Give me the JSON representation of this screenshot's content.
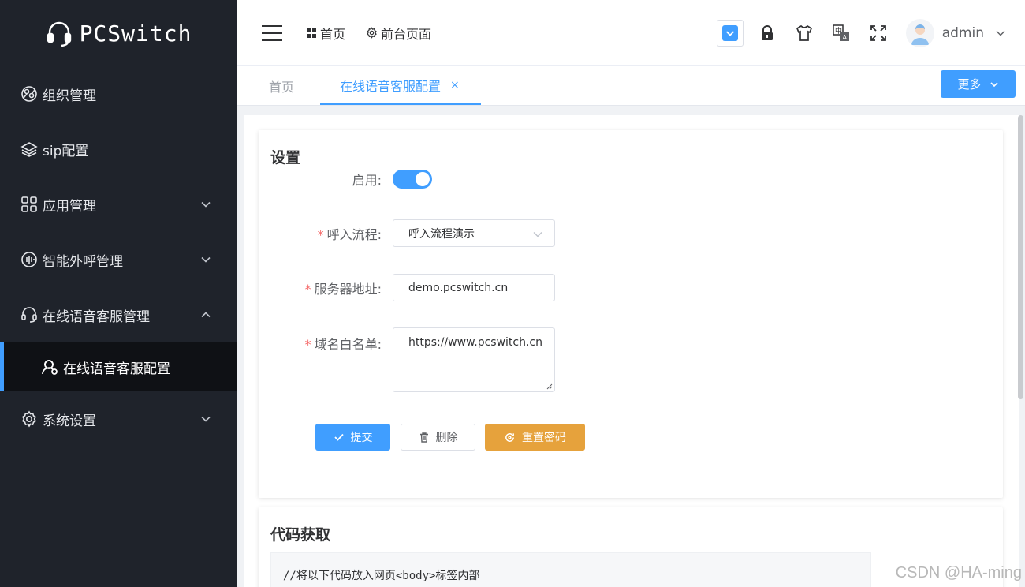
{
  "app": {
    "logo_text": "PCSwitch"
  },
  "sidebar": {
    "items": [
      {
        "label": "组织管理",
        "icon": "org-icon",
        "expandable": false
      },
      {
        "label": "sip配置",
        "icon": "layers-icon",
        "expandable": false
      },
      {
        "label": "应用管理",
        "icon": "apps-icon",
        "expandable": true,
        "expanded": false
      },
      {
        "label": "智能外呼管理",
        "icon": "waveform-icon",
        "expandable": true,
        "expanded": false
      },
      {
        "label": "在线语音客服管理",
        "icon": "headset-icon",
        "expandable": true,
        "expanded": true,
        "children": [
          {
            "label": "在线语音客服配置",
            "icon": "user-service-icon",
            "active": true
          }
        ]
      },
      {
        "label": "系统设置",
        "icon": "gear-icon",
        "expandable": true,
        "expanded": false
      }
    ]
  },
  "header": {
    "nav": [
      {
        "label": "首页",
        "icon": "grid-icon"
      },
      {
        "label": "前台页面",
        "icon": "gear-icon"
      }
    ],
    "username": "admin"
  },
  "tabs": {
    "items": [
      {
        "label": "首页",
        "active": false
      },
      {
        "label": "在线语音客服配置",
        "active": true,
        "closable": true
      }
    ],
    "close_glyph": "×",
    "more_label": "更多"
  },
  "settings_card": {
    "title": "设置",
    "fields": {
      "enable": {
        "label": "启用:",
        "value": true
      },
      "flow": {
        "label": "呼入流程:",
        "required": true,
        "value": "呼入流程演示"
      },
      "server": {
        "label": "服务器地址:",
        "required": true,
        "value": "demo.pcswitch.cn"
      },
      "whitelist": {
        "label": "域名白名单:",
        "required": true,
        "value": "https://www.pcswitch.cn"
      }
    },
    "required_mark": "*",
    "buttons": {
      "submit": "提交",
      "delete": "删除",
      "reset": "重置密码"
    }
  },
  "code_card": {
    "title": "代码获取",
    "code_first_line": "//将以下代码放入网页<body>标签内部"
  },
  "watermark": "CSDN @HA-ming",
  "colors": {
    "primary": "#409eff",
    "warning": "#e6a23c",
    "sidebar_bg": "#1f232b",
    "danger": "#f56c6c"
  }
}
